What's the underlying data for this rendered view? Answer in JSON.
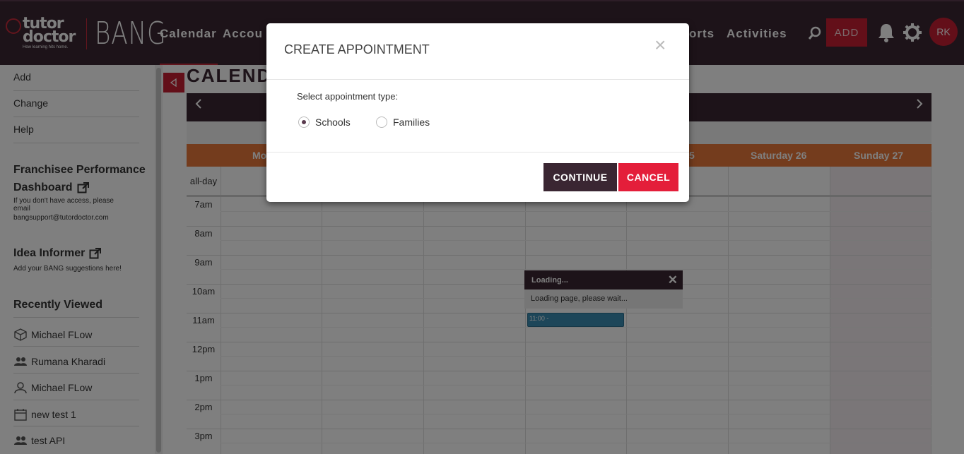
{
  "brand": {
    "logo_main": "tutor doctor",
    "logo_tagline": "How learning hits home.",
    "app_name": "BANG"
  },
  "nav": {
    "items": [
      "Calendar",
      "Accou",
      "orts",
      "Activities"
    ],
    "add_label": "ADD",
    "avatar_initials": "RK"
  },
  "sidebar": {
    "links": [
      "Add",
      "Change",
      "Help"
    ],
    "franchisee_title_1": "Franchisee Performance",
    "franchisee_title_2": "Dashboard",
    "franchisee_note_1": "If you don't have access, please",
    "franchisee_note_2": "email",
    "franchisee_note_3": "bangsupport@tutordoctor.com",
    "idea_title": "Idea Informer",
    "idea_note": "Add your BANG suggestions here!",
    "recent_title": "Recently Viewed",
    "recent": [
      {
        "label": "Michael FLow",
        "icon": "cube-icon"
      },
      {
        "label": "Rumana Kharadi",
        "icon": "users-icon"
      },
      {
        "label": "Michael FLow",
        "icon": "user-icon"
      },
      {
        "label": "new test 1",
        "icon": "calendar-icon"
      },
      {
        "label": "test API",
        "icon": "users-icon"
      }
    ]
  },
  "calendar": {
    "title": "CALEND",
    "days": [
      "Mo",
      "5",
      "Saturday 26",
      "Sunday 27"
    ],
    "allday_label": "all-day",
    "times": [
      "7am",
      "8am",
      "9am",
      "10am",
      "11am",
      "12pm",
      "1pm",
      "2pm",
      "3pm"
    ],
    "event_label": "11:00 -",
    "loading_title": "Loading...",
    "loading_body": "Loading page, please wait..."
  },
  "modal": {
    "title": "CREATE APPOINTMENT",
    "close_glyph": "×",
    "type_label": "Select appointment type:",
    "options": [
      "Schools",
      "Families"
    ],
    "selected": "Schools",
    "continue_label": "CONTINUE",
    "cancel_label": "CANCEL"
  },
  "colors": {
    "brand_dark": "#3a2632",
    "accent_red": "#c61f32",
    "day_header_orange": "#e8793b",
    "event_blue": "#3b8db2"
  }
}
